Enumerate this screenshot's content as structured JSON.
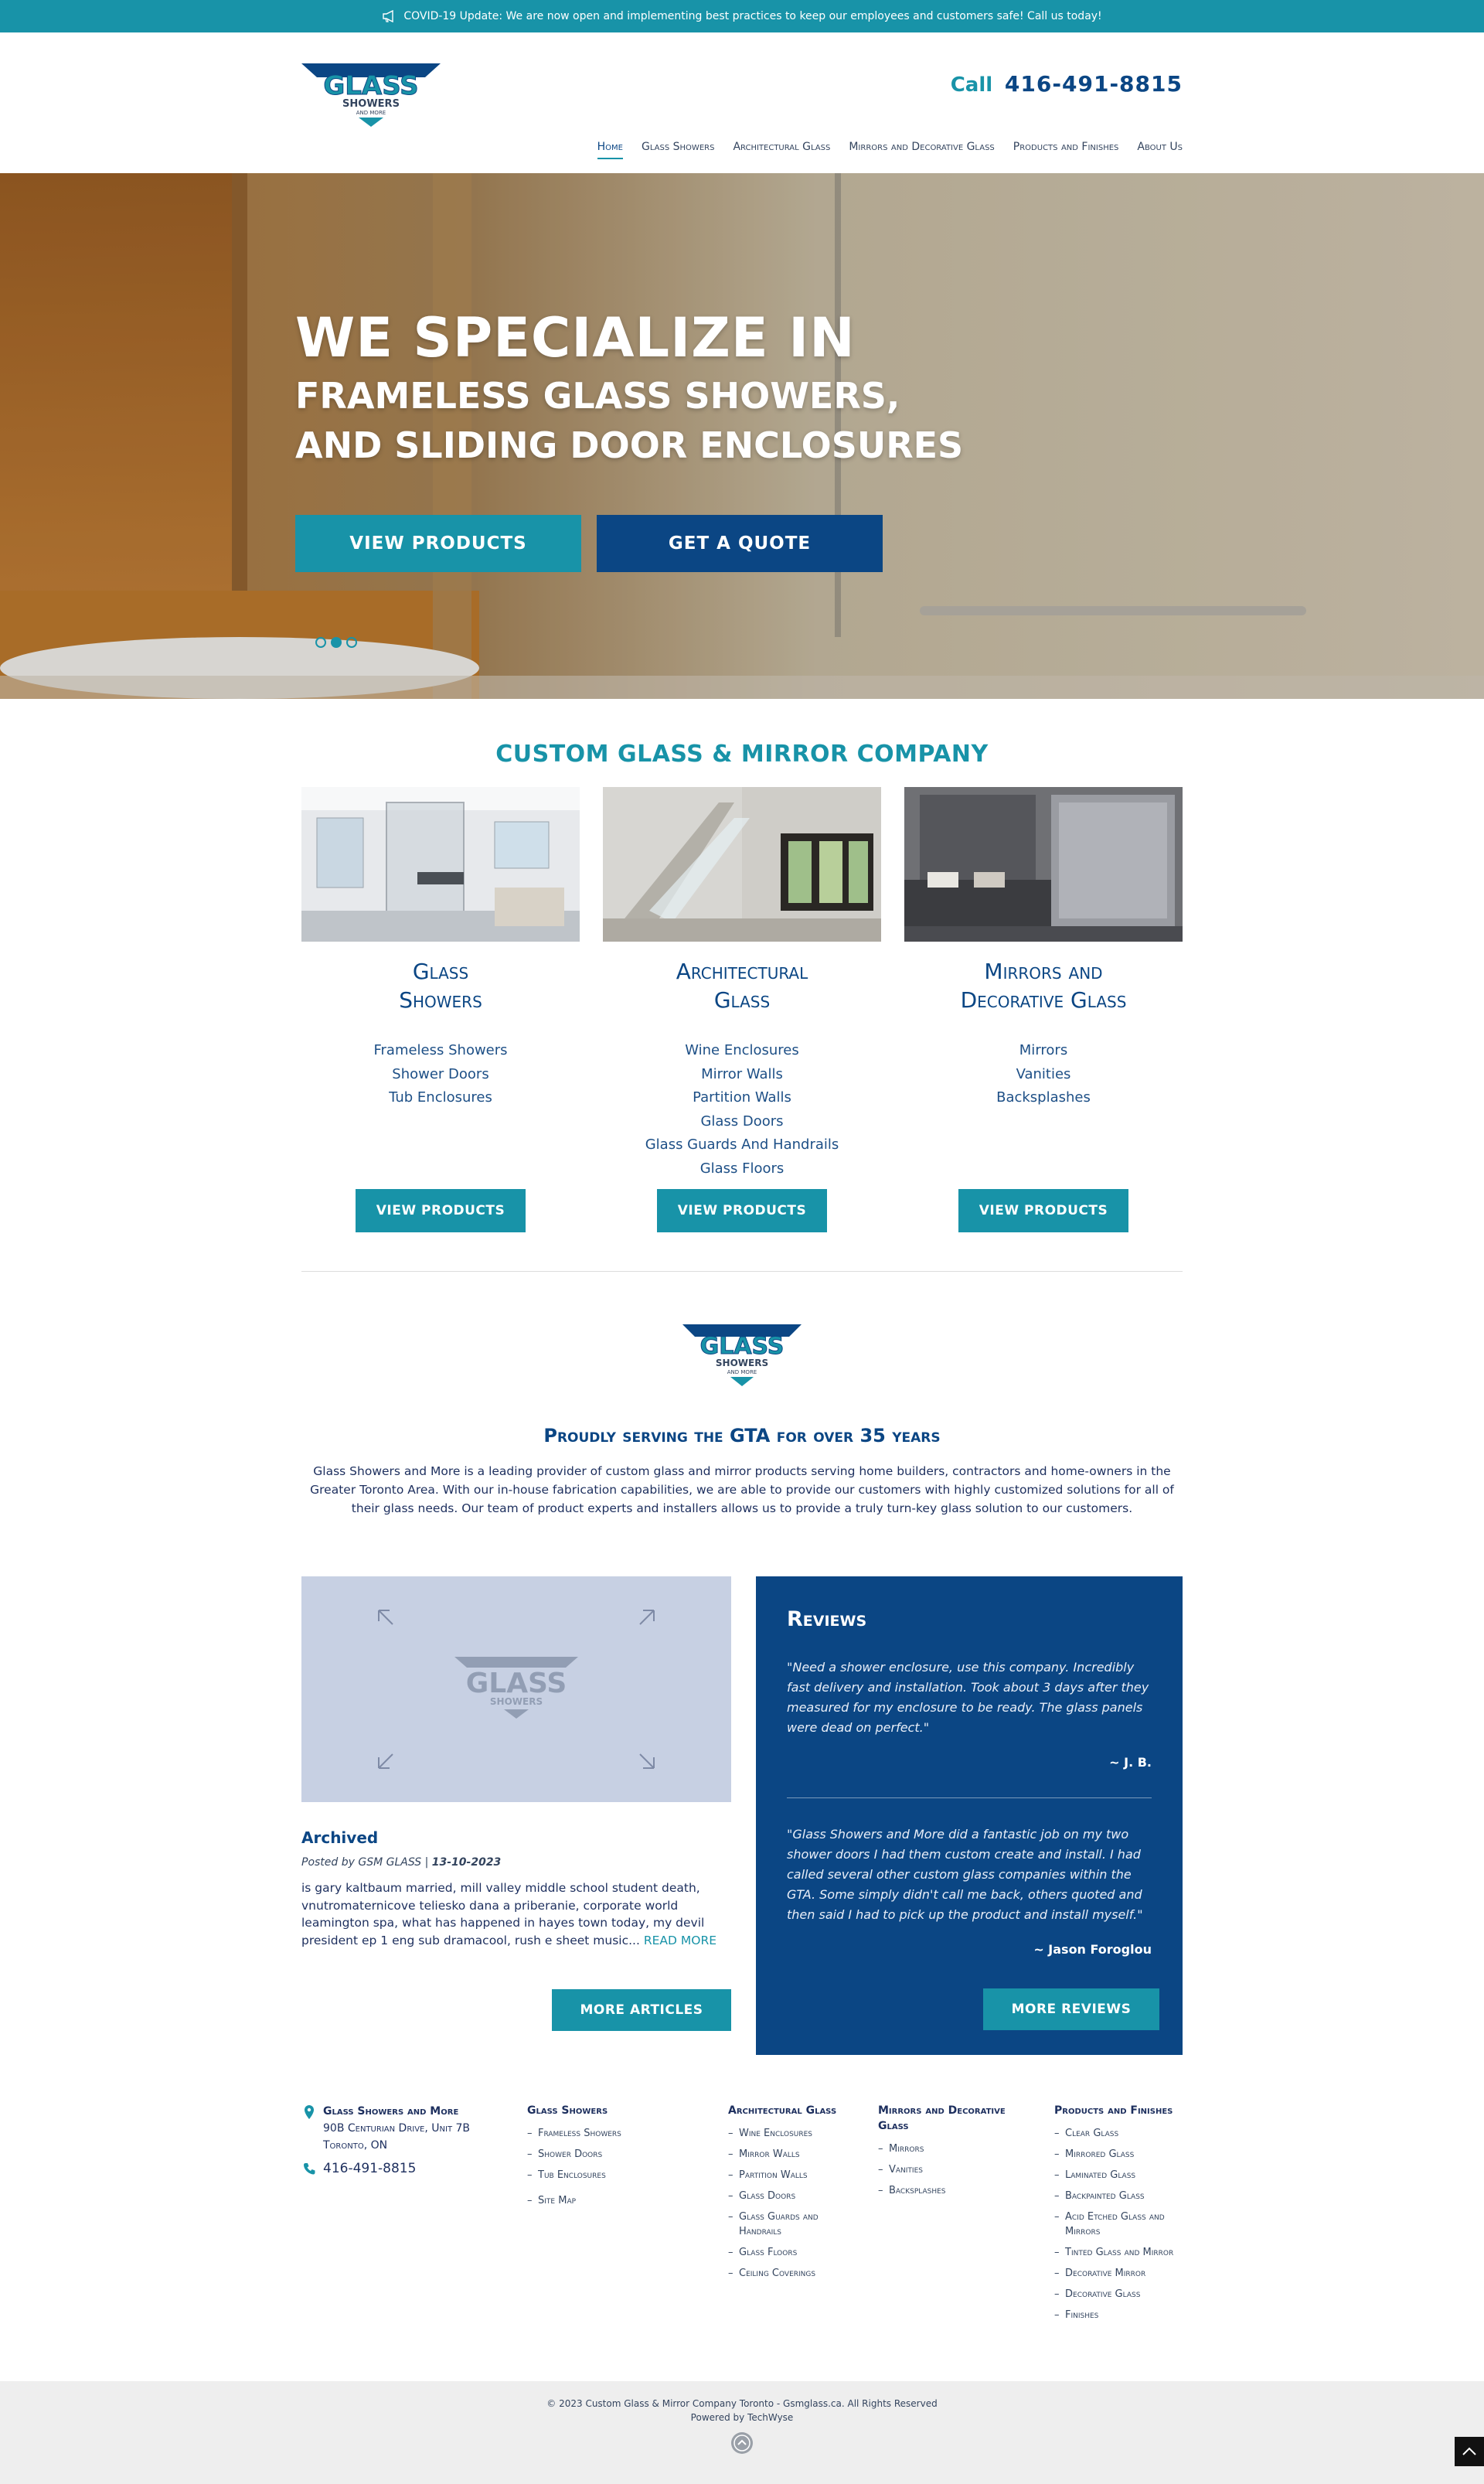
{
  "topbar": {
    "icon": "megaphone-icon",
    "message": "COVID-19 Update: We are now open and implementing best practices to keep our employees and customers safe! Call us today!"
  },
  "brand": {
    "logo_word": "GLASS",
    "logo_sub": "SHOWERS",
    "logo_small": "AND MORE",
    "colors": {
      "teal": "#1893a8",
      "navy": "#0b4684",
      "pale": "#c7d0e3"
    }
  },
  "header": {
    "call_label": "Call",
    "phone": "416-491-8815"
  },
  "nav": {
    "items": [
      {
        "label": "Home"
      },
      {
        "label": "Glass Showers"
      },
      {
        "label": "Architectural Glass"
      },
      {
        "label": "Mirrors and Decorative Glass"
      },
      {
        "label": "Products and Finishes"
      },
      {
        "label": "About Us"
      }
    ]
  },
  "hero": {
    "line1": "WE SPECIALIZE IN",
    "line2": "FRAMELESS GLASS SHOWERS,",
    "line3": "AND SLIDING DOOR ENCLOSURES",
    "btn_products": "VIEW PRODUCTS",
    "btn_quote": "GET A QUOTE",
    "slides": 3,
    "active_slide": 2
  },
  "company": {
    "title": "CUSTOM GLASS & MIRROR COMPANY",
    "cards": [
      {
        "title_l1": "Glass",
        "title_l2": "Showers",
        "items": [
          "Frameless Showers",
          "Shower Doors",
          "Tub Enclosures"
        ],
        "button": "VIEW PRODUCTS"
      },
      {
        "title_l1": "Architectural",
        "title_l2": "Glass",
        "items": [
          "Wine Enclosures",
          "Mirror Walls",
          "Partition Walls",
          "Glass Doors",
          "Glass Guards And Handrails",
          "Glass Floors"
        ],
        "button": "VIEW PRODUCTS"
      },
      {
        "title_l1": "Mirrors and",
        "title_l2": "Decorative Glass",
        "items": [
          "Mirrors",
          "Vanities",
          "Backsplashes"
        ],
        "button": "VIEW PRODUCTS"
      }
    ]
  },
  "about": {
    "title": "Proudly serving the GTA for over 35 years",
    "text": "Glass Showers and More is a leading provider of custom glass and mirror products serving home builders, contractors and home-owners in the Greater Toronto Area. With our in-house fabrication capabilities, we are able to provide our customers with highly customized solutions for all of their glass needs. Our team of product experts and installers allows us to provide a truly turn-key glass solution to our customers."
  },
  "article": {
    "title": "Archived",
    "posted_by": "Posted by GSM GLASS |",
    "date": "13-10-2023",
    "body": "is gary kaltbaum married, mill valley middle school student death, vnutromaternicove teliesko dana a priberanie, corporate world leamington spa, what has happened in hayes town today, my devil president ep 1 eng sub dramacool, rush e sheet music...",
    "read_more": "READ MORE",
    "more_button": "MORE ARTICLES"
  },
  "reviews": {
    "title": "Reviews",
    "items": [
      {
        "quote": "\"Need a shower enclosure, use this company. Incredibly fast delivery and installation. Took about 3 days after they measured for my enclosure to be ready. The glass panels were dead on perfect.\"",
        "author": "~ J. B."
      },
      {
        "quote": "\"Glass Showers and More did a fantastic job on my two shower doors I had them custom create and install. I had called several other custom glass companies within the GTA. Some simply didn't call me back, others quoted and then said I had to pick up the product and install myself.\"",
        "author": "~ Jason Foroglou"
      }
    ],
    "more_button": "MORE REVIEWS"
  },
  "footer": {
    "contact": {
      "name": "Glass Showers and More",
      "address1": "90B Centurian Drive, Unit 7B",
      "address2": "Toronto, ON",
      "phone": "416-491-8815"
    },
    "columns": [
      {
        "title": "Glass Showers",
        "items": [
          "Frameless Showers",
          "Shower Doors",
          "Tub Enclosures",
          "Site Map"
        ]
      },
      {
        "title": "Architectural Glass",
        "items": [
          "Wine Enclosures",
          "Mirror Walls",
          "Partition Walls",
          "Glass Doors",
          "Glass Guards and Handrails",
          "Glass Floors",
          "Ceiling Coverings"
        ]
      },
      {
        "title": "Mirrors and Decorative Glass",
        "items": [
          "Mirrors",
          "Vanities",
          "Backsplashes"
        ]
      },
      {
        "title": "Products and Finishes",
        "items": [
          "Clear Glass",
          "Mirrored Glass",
          "Laminated Glass",
          "Backpainted Glass",
          "Acid Etched Glass and Mirrors",
          "Tinted Glass and Mirror",
          "Decorative Mirror",
          "Decorative Glass",
          "Finishes"
        ]
      }
    ],
    "copyright": "© 2023 Custom Glass & Mirror Company Toronto - Gsmglass.ca. All Rights Reserved",
    "powered": "Powered by TechWyse"
  }
}
